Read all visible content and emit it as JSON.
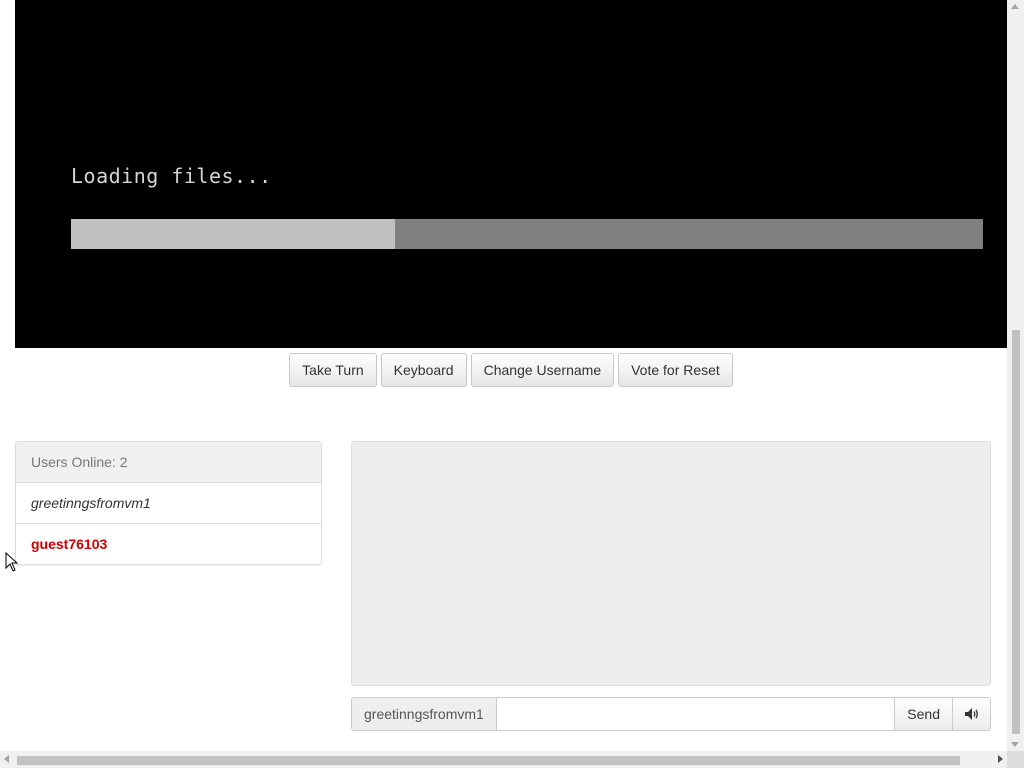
{
  "vm": {
    "status_text": "Loading files...",
    "progress": 0.355
  },
  "toolbar": {
    "take_turn_label": "Take Turn",
    "keyboard_label": "Keyboard",
    "change_username_label": "Change Username",
    "vote_reset_label": "Vote for Reset"
  },
  "users": {
    "header": "Users Online: 2",
    "list": [
      {
        "name": "greetinngsfromvm1",
        "style": "italic"
      },
      {
        "name": "guest76103",
        "style": "self",
        "color": "#cc0000"
      }
    ]
  },
  "chat": {
    "username": "greetinngsfromvm1",
    "input_value": "",
    "send_label": "Send",
    "sound_icon": "speaker-icon"
  }
}
